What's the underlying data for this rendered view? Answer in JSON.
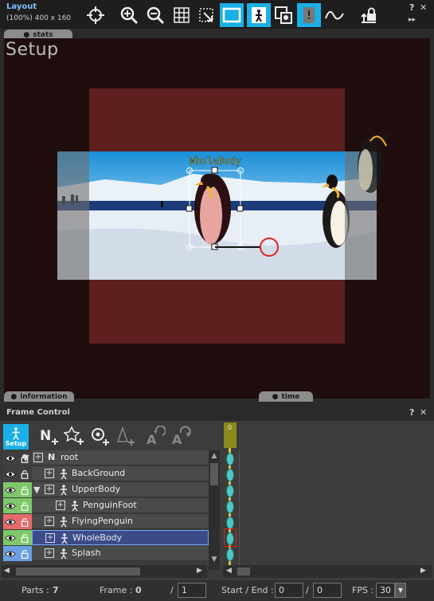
{
  "layout": {
    "title": "Layout",
    "subtitle": "(100%) 400 x 160",
    "help": "?",
    "close": "✕",
    "expand": "▸▸",
    "stats_label": "stats",
    "mode_label": "Setup",
    "information_label": "information",
    "time_label": "time",
    "bone_label": "WholeBody",
    "toolbar": [
      {
        "icon": "move-crosshair-icon",
        "active": false
      },
      {
        "icon": "zoom-in-icon",
        "active": false
      },
      {
        "icon": "zoom-out-icon",
        "active": false
      },
      {
        "icon": "grid-icon",
        "active": false
      },
      {
        "icon": "resize-select-icon",
        "active": false
      },
      {
        "icon": "frame-box-icon",
        "active": true
      },
      {
        "icon": "figure-icon",
        "active": true
      },
      {
        "icon": "layer-icon",
        "active": false
      },
      {
        "icon": "info-box-icon",
        "active": true
      },
      {
        "icon": "curve-icon",
        "active": false
      },
      {
        "icon": "lock-export-icon",
        "active": false
      }
    ]
  },
  "frame_control": {
    "title": "Frame Control",
    "help": "?",
    "close": "✕",
    "setup_label": "Setup",
    "tools": [
      "new-part-icon",
      "new-star-icon",
      "add-point-icon",
      "add-shape-icon",
      "rotate-a-icon",
      "rotate-a2-icon"
    ],
    "frame_marker": "0",
    "tree": [
      {
        "label": "root",
        "indent": 0,
        "color": "#3f3f3f",
        "expander": "▼",
        "kind": "N"
      },
      {
        "label": "BackGround",
        "indent": 1,
        "color": "#3f3f3f",
        "expander": "",
        "kind": "figure"
      },
      {
        "label": "UpperBody",
        "indent": 1,
        "color": "#7ec86a",
        "expander": "▼",
        "kind": "figure"
      },
      {
        "label": "PenguinFoot",
        "indent": 2,
        "color": "#7ec86a",
        "expander": "",
        "kind": "figure"
      },
      {
        "label": "FlyingPenguin",
        "indent": 1,
        "color": "#e36b6b",
        "expander": "",
        "kind": "figure"
      },
      {
        "label": "WholeBody",
        "indent": 1,
        "color": "#7ec86a",
        "expander": "",
        "kind": "figure",
        "selected": true
      },
      {
        "label": "Splash",
        "indent": 1,
        "color": "#6aa0e3",
        "expander": "",
        "kind": "figure"
      }
    ],
    "status": {
      "parts_label": "Parts :",
      "parts_value": "7",
      "frame_label": "Frame :",
      "frame_value": "0",
      "frame_sep": "/",
      "frame_total": "1",
      "startend_label": "Start / End :",
      "start_value": "0",
      "end_sep": "/",
      "end_value": "0",
      "fps_label": "FPS :",
      "fps_value": "30"
    }
  },
  "colors": {
    "accent": "#1ab0e6",
    "canvas_red": "#5e1f1f",
    "selection_blue": "#3c4c8a",
    "timeline_gold": "#8a8a1a",
    "key_cyan": "#4ec8c0"
  }
}
